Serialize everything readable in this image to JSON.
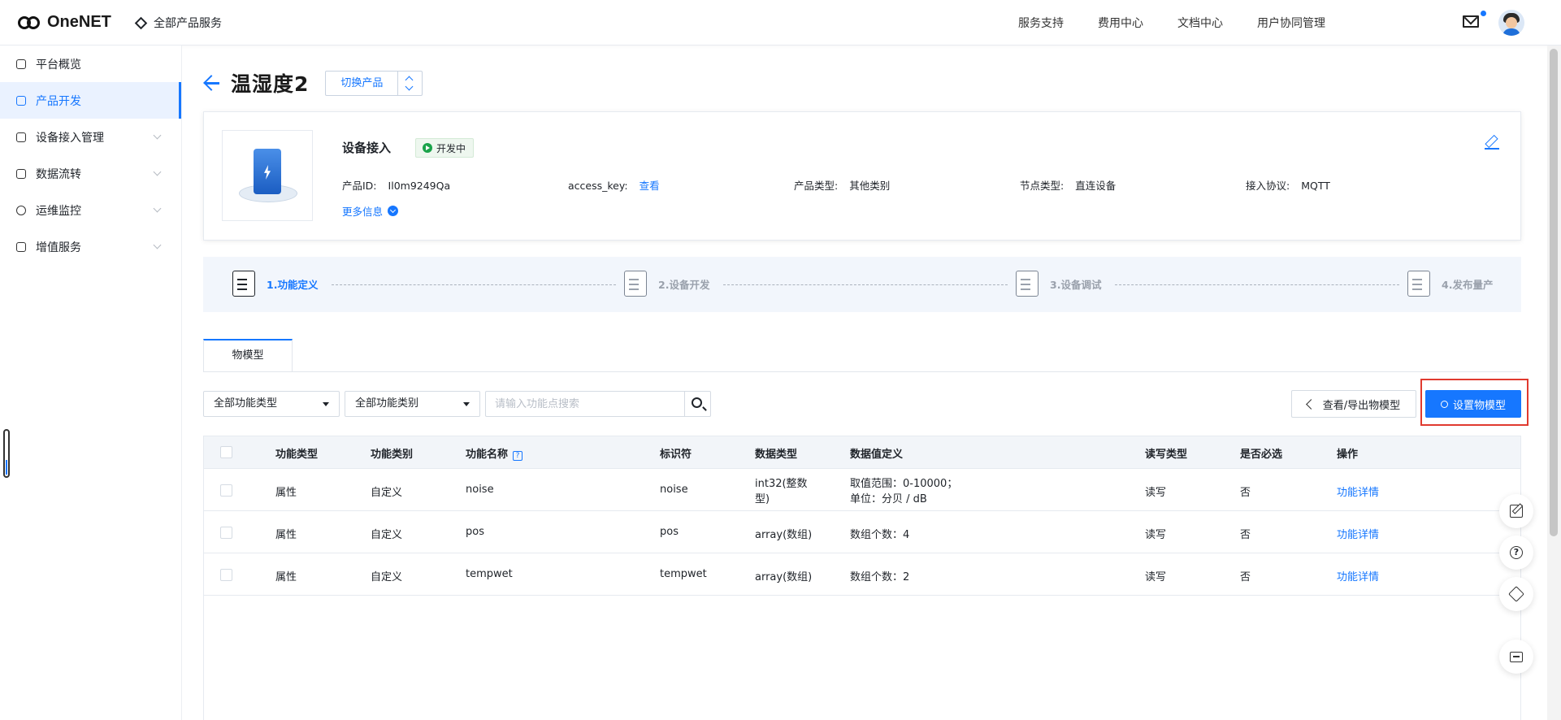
{
  "brand": {
    "name": "OneNET"
  },
  "topbar": {
    "all_products": "全部产品服务",
    "nav": [
      "服务支持",
      "费用中心",
      "文档中心",
      "用户协同管理"
    ]
  },
  "sidebar": {
    "items": [
      {
        "label": "平台概览",
        "icon": "dashboard-icon",
        "active": false,
        "expandable": false
      },
      {
        "label": "产品开发",
        "icon": "cube-icon",
        "active": true,
        "expandable": false
      },
      {
        "label": "设备接入管理",
        "icon": "device-icon",
        "active": false,
        "expandable": true
      },
      {
        "label": "数据流转",
        "icon": "flow-icon",
        "active": false,
        "expandable": true
      },
      {
        "label": "运维监控",
        "icon": "monitor-icon",
        "active": false,
        "expandable": true
      },
      {
        "label": "增值服务",
        "icon": "plane-icon",
        "active": false,
        "expandable": true
      }
    ]
  },
  "header": {
    "title": "温湿度2",
    "switch_label": "切换产品"
  },
  "card": {
    "title": "设备接入",
    "status": "开发中",
    "fields": [
      {
        "key": "产品ID:",
        "value": "Il0m9249Qa",
        "link": false
      },
      {
        "key": "access_key:",
        "value": "查看",
        "link": true
      },
      {
        "key": "产品类型:",
        "value": "其他类别",
        "link": false
      },
      {
        "key": "节点类型:",
        "value": "直连设备",
        "link": false
      },
      {
        "key": "接入协议:",
        "value": "MQTT",
        "link": false
      }
    ],
    "more_info": "更多信息"
  },
  "steps": [
    {
      "label": "1.功能定义",
      "active": true
    },
    {
      "label": "2.设备开发",
      "active": false
    },
    {
      "label": "3.设备调试",
      "active": false
    },
    {
      "label": "4.发布量产",
      "active": false
    }
  ],
  "tab": {
    "label": "物模型"
  },
  "filters": {
    "type_select": "全部功能类型",
    "category_select": "全部功能类别",
    "search_placeholder": "请输入功能点搜索"
  },
  "actions": {
    "export_label": "查看/导出物模型",
    "setup_label": "设置物模型"
  },
  "table": {
    "headers": [
      "功能类型",
      "功能类别",
      "功能名称",
      "标识符",
      "数据类型",
      "数据值定义",
      "读写类型",
      "是否必选",
      "操作"
    ],
    "rows": [
      {
        "type": "属性",
        "category": "自定义",
        "name": "noise",
        "id": "noise",
        "dtype": [
          "int32(整数",
          "型)"
        ],
        "define": [
          "取值范围：0-10000；",
          "单位：分贝 / dB"
        ],
        "rw": "读写",
        "required": "否",
        "action": "功能详情"
      },
      {
        "type": "属性",
        "category": "自定义",
        "name": "pos",
        "id": "pos",
        "dtype": [
          "array(数组)"
        ],
        "define": [
          "数组个数：4"
        ],
        "rw": "读写",
        "required": "否",
        "action": "功能详情"
      },
      {
        "type": "属性",
        "category": "自定义",
        "name": "tempwet",
        "id": "tempwet",
        "dtype": [
          "array(数组)"
        ],
        "define": [
          "数组个数：2"
        ],
        "rw": "读写",
        "required": "否",
        "action": "功能详情"
      }
    ]
  },
  "colors": {
    "accent": "#1677ff",
    "highlight": "#e03a2f",
    "status_green": "#1aa34a"
  }
}
